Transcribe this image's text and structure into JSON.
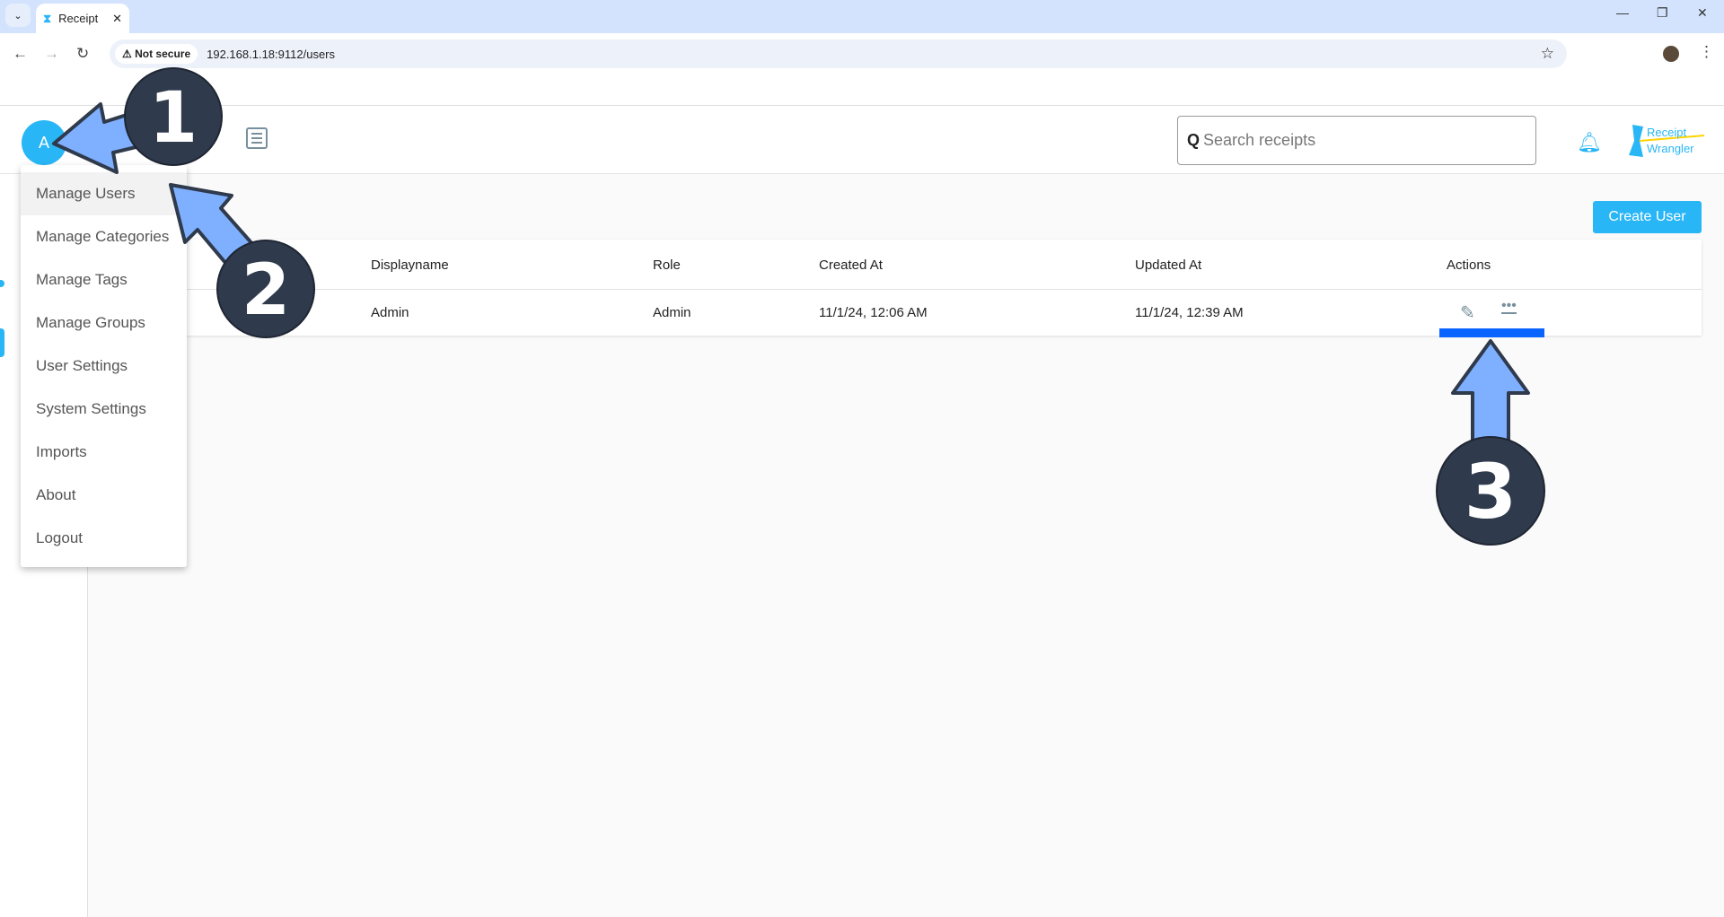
{
  "browser": {
    "tab_title": "Receipt",
    "url": "192.168.1.18:9112/users",
    "security_label": "Not secure"
  },
  "header": {
    "avatar_letter": "A",
    "search_placeholder": "Search receipts",
    "logo_text": [
      "Receipt",
      "Wrangler"
    ]
  },
  "page": {
    "create_user_label": "Create User"
  },
  "table": {
    "columns": [
      "Displayname",
      "Role",
      "Created At",
      "Updated At",
      "Actions"
    ],
    "rows": [
      {
        "displayname": "Admin",
        "role": "Admin",
        "created_at": "11/1/24, 12:06 AM",
        "updated_at": "11/1/24, 12:39 AM"
      }
    ]
  },
  "menu": {
    "items": [
      "Manage Users",
      "Manage Categories",
      "Manage Tags",
      "Manage Groups",
      "User Settings",
      "System Settings",
      "Imports",
      "About",
      "Logout"
    ],
    "active": "Manage Users"
  },
  "annotations": {
    "steps": [
      "1",
      "2",
      "3"
    ]
  },
  "colors": {
    "accent": "#29b6f6",
    "annotation_arrow": "#7fb0ff",
    "annotation_circle": "#2f3a4c",
    "highlight_bar": "#0a64ff"
  }
}
